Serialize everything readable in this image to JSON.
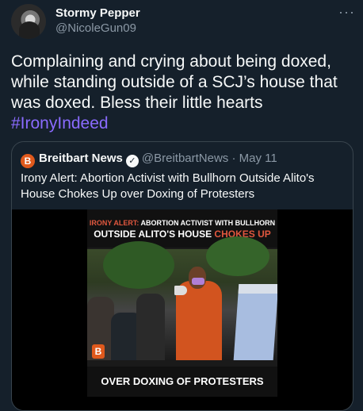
{
  "author": {
    "display_name": "Stormy Pepper",
    "handle": "@NicoleGun09"
  },
  "tweet": {
    "text": "Complaining and crying about being doxed, while standing outside of a SCJ’s house that was doxed. Bless their little hearts ",
    "hashtag": "#IronyIndeed"
  },
  "quoted": {
    "logo_letter": "B",
    "name": "Breitbart News",
    "handle": "@BreitbartNews",
    "separator": "·",
    "date": "May 11",
    "text": "Irony Alert: Abortion Activist with Bullhorn Outside Alito's House Chokes Up over Doxing of Protesters",
    "media": {
      "banner_top_red": "IRONY ALERT:",
      "banner_top_white": " ABORTION ACTIVIST WITH BULLHORN",
      "banner_mid_white": "OUTSIDE ALITO'S HOUSE ",
      "banner_mid_red": "CHOKES UP",
      "banner_bottom": "OVER DOXING OF PROTESTERS",
      "badge_letter": "B"
    }
  },
  "icons": {
    "more": "more-horizontal-icon",
    "verified": "verified-badge-icon"
  },
  "colors": {
    "background": "#15202b",
    "accent": "#8a6bff",
    "brand": "#e0591c"
  }
}
